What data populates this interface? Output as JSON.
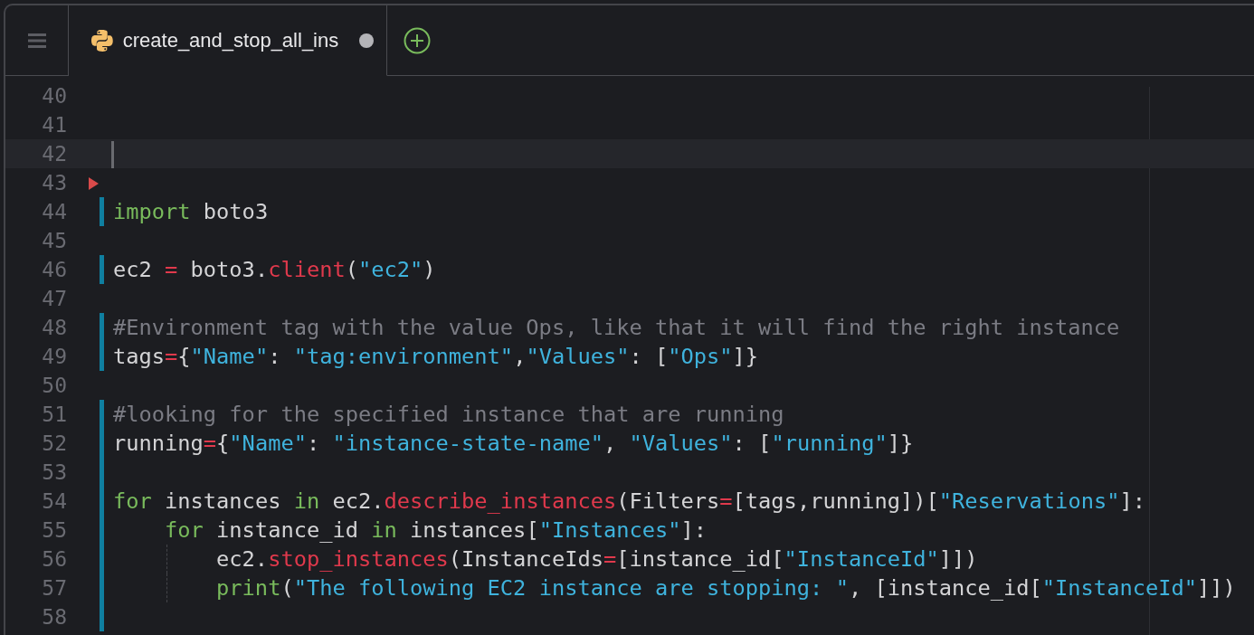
{
  "tabs": [
    {
      "title": "create_and_stop_all_ins",
      "selected": true,
      "modified": true
    }
  ],
  "editor": {
    "lines": [
      {
        "number": "40",
        "changed": false,
        "current": false,
        "marker": false
      },
      {
        "number": "41",
        "changed": false,
        "current": false,
        "marker": false
      },
      {
        "number": "42",
        "changed": false,
        "current": true,
        "marker": false
      },
      {
        "number": "43",
        "changed": false,
        "current": false,
        "marker": true
      },
      {
        "number": "44",
        "changed": true,
        "current": false,
        "marker": false,
        "tokens": [
          {
            "kind": "keyword",
            "text": "import"
          },
          {
            "kind": "plain",
            "text": " boto3"
          }
        ]
      },
      {
        "number": "45",
        "changed": false,
        "current": false,
        "marker": false
      },
      {
        "number": "46",
        "changed": true,
        "current": false,
        "marker": false,
        "tokens": [
          {
            "kind": "plain",
            "text": "ec2 "
          },
          {
            "kind": "operator",
            "text": "="
          },
          {
            "kind": "plain",
            "text": " boto3."
          },
          {
            "kind": "call",
            "text": "client"
          },
          {
            "kind": "plain",
            "text": "("
          },
          {
            "kind": "string",
            "text": "\"ec2\""
          },
          {
            "kind": "plain",
            "text": ")"
          }
        ]
      },
      {
        "number": "47",
        "changed": false,
        "current": false,
        "marker": false
      },
      {
        "number": "48",
        "changed": true,
        "current": false,
        "marker": false,
        "tokens": [
          {
            "kind": "comment",
            "text": "#Environment tag with the value Ops, like that it will find the right instance"
          }
        ]
      },
      {
        "number": "49",
        "changed": true,
        "current": false,
        "marker": false,
        "tokens": [
          {
            "kind": "plain",
            "text": "tags"
          },
          {
            "kind": "operator",
            "text": "="
          },
          {
            "kind": "plain",
            "text": "{"
          },
          {
            "kind": "string",
            "text": "\"Name\""
          },
          {
            "kind": "plain",
            "text": ": "
          },
          {
            "kind": "string",
            "text": "\"tag:environment\""
          },
          {
            "kind": "plain",
            "text": ","
          },
          {
            "kind": "string",
            "text": "\"Values\""
          },
          {
            "kind": "plain",
            "text": ": ["
          },
          {
            "kind": "string",
            "text": "\"Ops\""
          },
          {
            "kind": "plain",
            "text": "]}"
          }
        ]
      },
      {
        "number": "50",
        "changed": false,
        "current": false,
        "marker": false
      },
      {
        "number": "51",
        "changed": true,
        "current": false,
        "marker": false,
        "tokens": [
          {
            "kind": "comment",
            "text": "#looking for the specified instance that are running"
          }
        ]
      },
      {
        "number": "52",
        "changed": true,
        "current": false,
        "marker": false,
        "tokens": [
          {
            "kind": "plain",
            "text": "running"
          },
          {
            "kind": "operator",
            "text": "="
          },
          {
            "kind": "plain",
            "text": "{"
          },
          {
            "kind": "string",
            "text": "\"Name\""
          },
          {
            "kind": "plain",
            "text": ": "
          },
          {
            "kind": "string",
            "text": "\"instance-state-name\""
          },
          {
            "kind": "plain",
            "text": ", "
          },
          {
            "kind": "string",
            "text": "\"Values\""
          },
          {
            "kind": "plain",
            "text": ": ["
          },
          {
            "kind": "string",
            "text": "\"running\""
          },
          {
            "kind": "plain",
            "text": "]}"
          }
        ]
      },
      {
        "number": "53",
        "changed": true,
        "current": false,
        "marker": false
      },
      {
        "number": "54",
        "changed": true,
        "current": false,
        "marker": false,
        "tokens": [
          {
            "kind": "keyword",
            "text": "for"
          },
          {
            "kind": "plain",
            "text": " instances "
          },
          {
            "kind": "keyword",
            "text": "in"
          },
          {
            "kind": "plain",
            "text": " ec2."
          },
          {
            "kind": "call",
            "text": "describe_instances"
          },
          {
            "kind": "plain",
            "text": "(Filters"
          },
          {
            "kind": "operator",
            "text": "="
          },
          {
            "kind": "plain",
            "text": "[tags,running])["
          },
          {
            "kind": "string",
            "text": "\"Reservations\""
          },
          {
            "kind": "plain",
            "text": "]:"
          }
        ]
      },
      {
        "number": "55",
        "changed": true,
        "current": false,
        "marker": false,
        "tokens": [
          {
            "kind": "keyword",
            "text": "    for"
          },
          {
            "kind": "plain",
            "text": " instance_id "
          },
          {
            "kind": "keyword",
            "text": "in"
          },
          {
            "kind": "plain",
            "text": " instances["
          },
          {
            "kind": "string",
            "text": "\"Instances\""
          },
          {
            "kind": "plain",
            "text": "]:"
          }
        ]
      },
      {
        "number": "56",
        "changed": true,
        "current": false,
        "marker": false,
        "tokens": [
          {
            "kind": "plain",
            "text": "        ec2."
          },
          {
            "kind": "call",
            "text": "stop_instances"
          },
          {
            "kind": "plain",
            "text": "(InstanceIds"
          },
          {
            "kind": "operator",
            "text": "="
          },
          {
            "kind": "plain",
            "text": "[instance_id["
          },
          {
            "kind": "string",
            "text": "\"InstanceId\""
          },
          {
            "kind": "plain",
            "text": "]])"
          }
        ]
      },
      {
        "number": "57",
        "changed": true,
        "current": false,
        "marker": false,
        "tokens": [
          {
            "kind": "keyword",
            "text": "        print"
          },
          {
            "kind": "plain",
            "text": "("
          },
          {
            "kind": "string",
            "text": "\"The following EC2 instance are stopping: \""
          },
          {
            "kind": "plain",
            "text": ", [instance_id["
          },
          {
            "kind": "string",
            "text": "\"InstanceId\""
          },
          {
            "kind": "plain",
            "text": "]])"
          }
        ]
      },
      {
        "number": "58",
        "changed": true,
        "current": false,
        "marker": false
      }
    ]
  }
}
